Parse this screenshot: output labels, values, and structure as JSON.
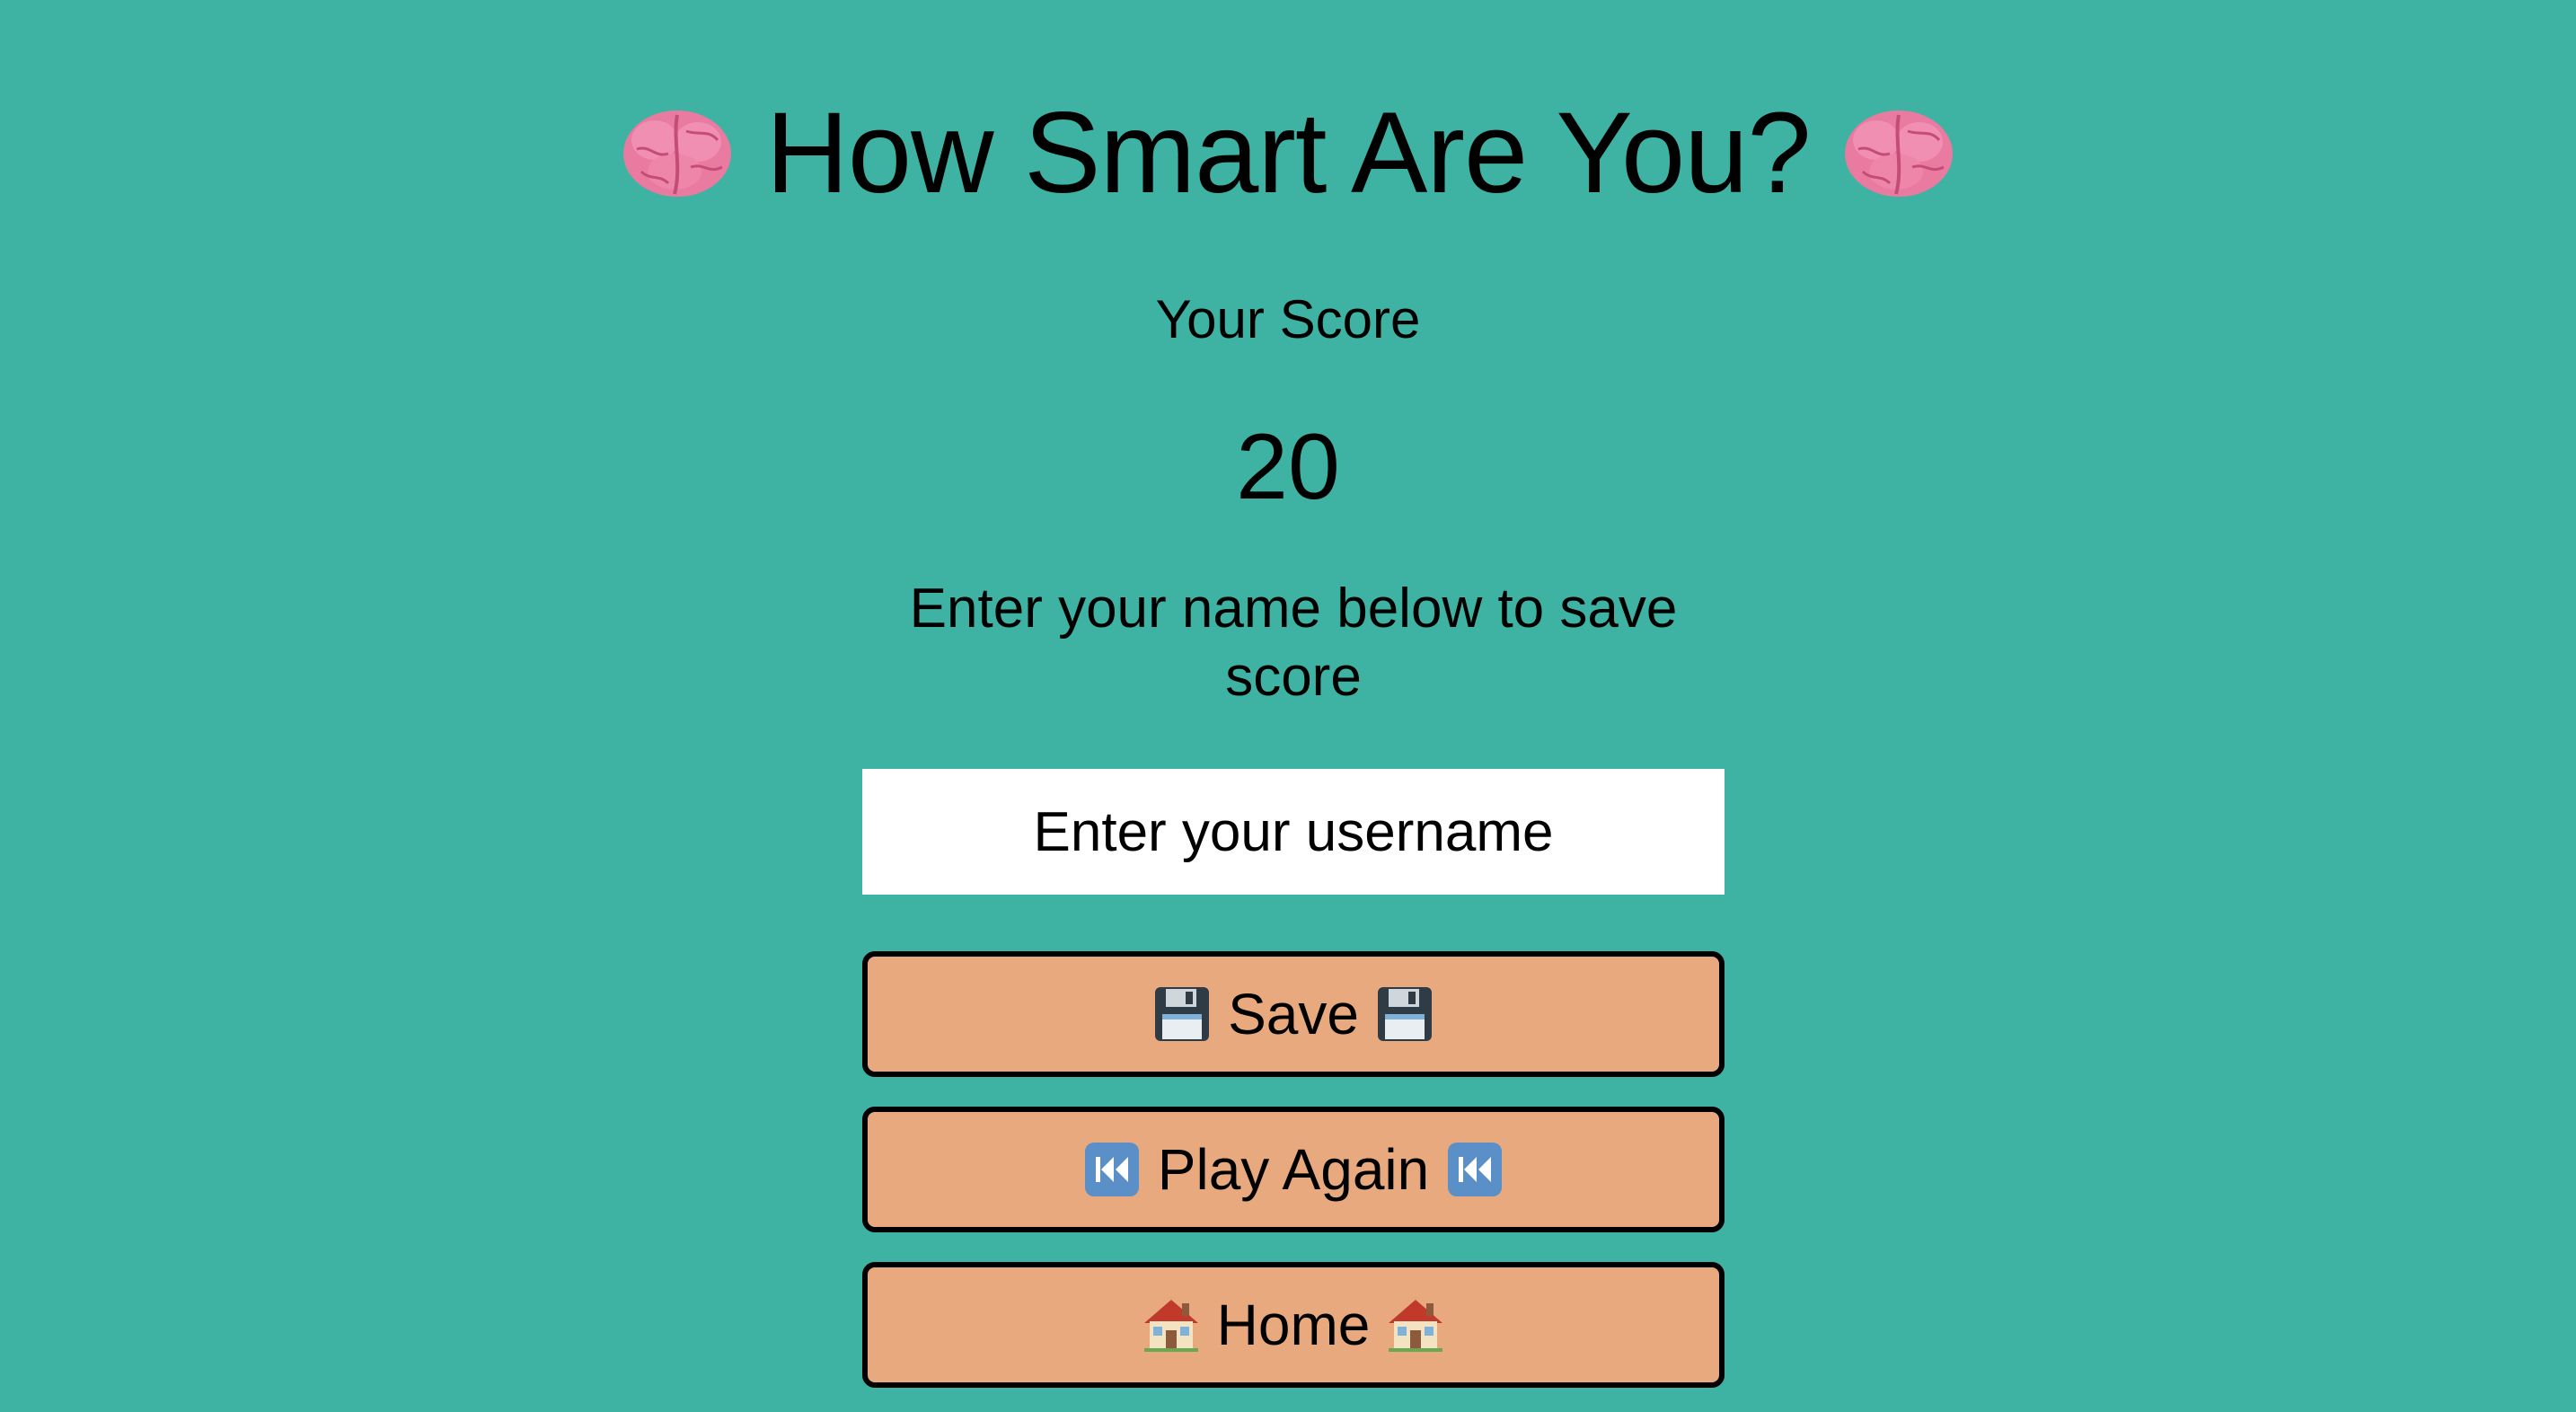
{
  "title": "How Smart Are You?",
  "title_icon": "brain-icon",
  "score": {
    "label": "Your Score",
    "value": "20"
  },
  "save_instructions": "Enter your name below to save score",
  "username_input": {
    "placeholder": "Enter your username",
    "value": ""
  },
  "buttons": {
    "save": {
      "label": "Save",
      "icon": "floppy-disk-icon"
    },
    "play_again": {
      "label": "Play Again",
      "icon": "rewind-icon"
    },
    "home": {
      "label": "Home",
      "icon": "house-icon"
    }
  },
  "colors": {
    "background": "#3fb3a3",
    "button": "#e8a97f",
    "input": "#ffffff",
    "text": "#000000"
  }
}
